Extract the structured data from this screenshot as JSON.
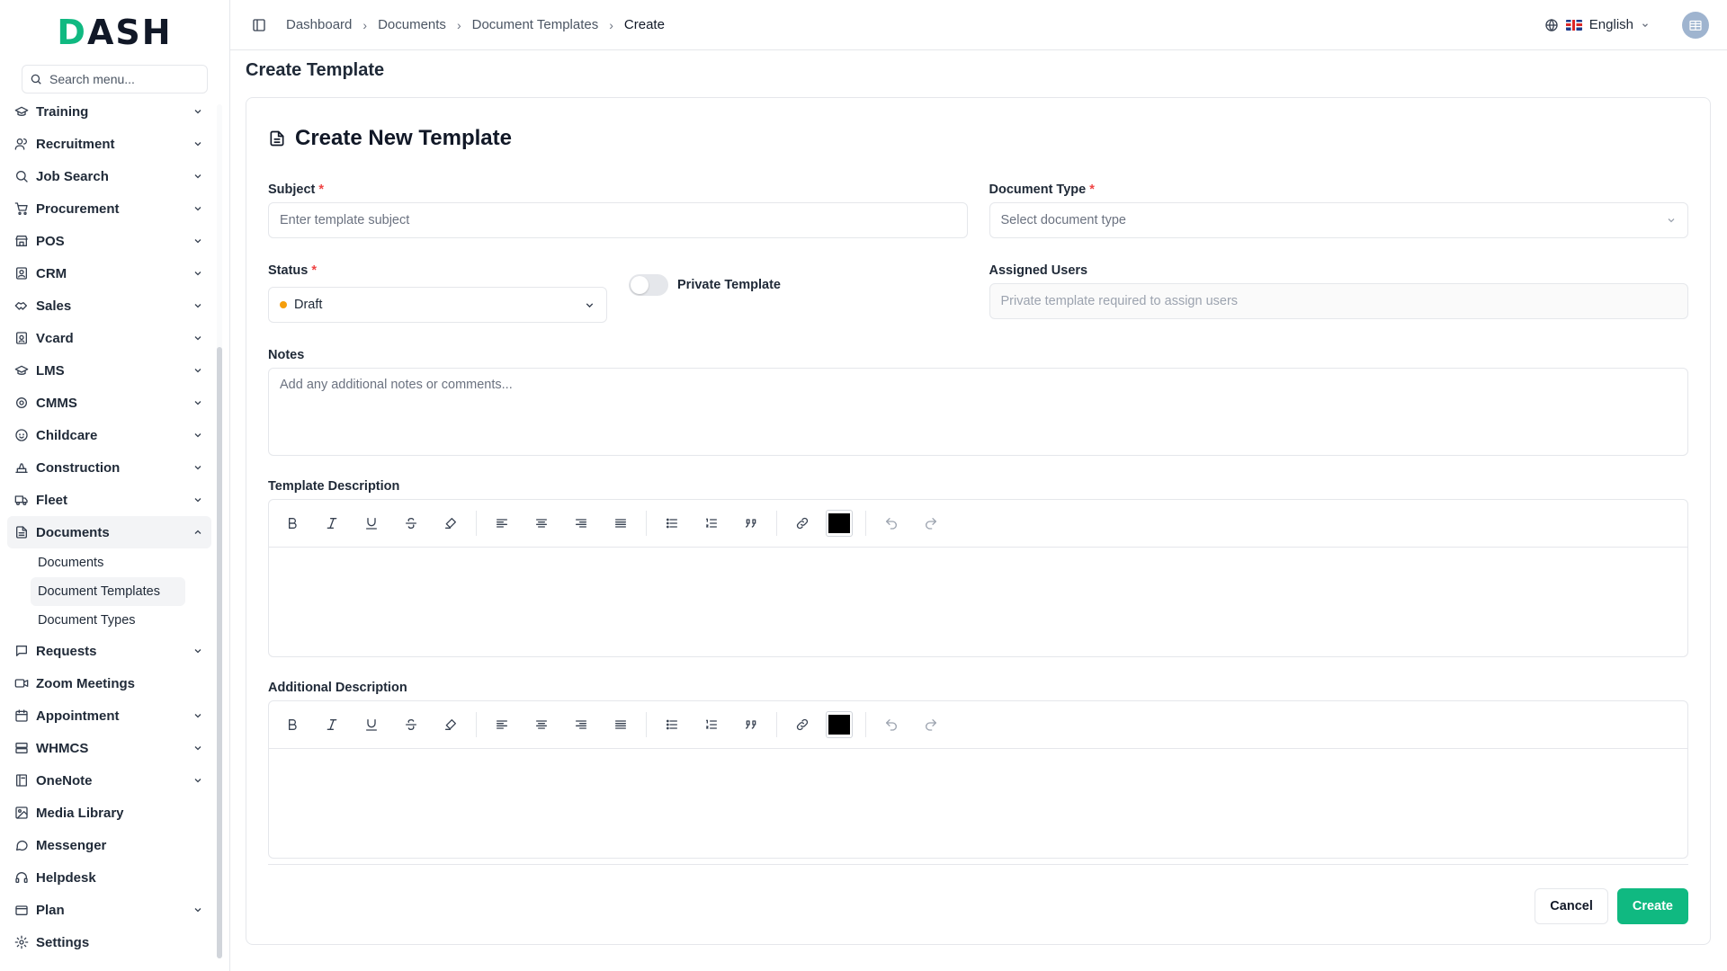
{
  "app": {
    "logo": "DASH"
  },
  "sidebar": {
    "search_placeholder": "Search menu...",
    "items": [
      {
        "label": "Training",
        "icon": "graduation-icon",
        "chevron": "down"
      },
      {
        "label": "Recruitment",
        "icon": "users-icon",
        "chevron": "down"
      },
      {
        "label": "Job Search",
        "icon": "search-icon",
        "chevron": "down"
      },
      {
        "label": "Procurement",
        "icon": "cart-icon",
        "chevron": "down"
      },
      {
        "label": "POS",
        "icon": "store-icon",
        "chevron": "down"
      },
      {
        "label": "CRM",
        "icon": "contact-icon",
        "chevron": "down"
      },
      {
        "label": "Sales",
        "icon": "handshake-icon",
        "chevron": "down"
      },
      {
        "label": "Vcard",
        "icon": "id-card-icon",
        "chevron": "down"
      },
      {
        "label": "LMS",
        "icon": "mortarboard-icon",
        "chevron": "down"
      },
      {
        "label": "CMMS",
        "icon": "cog-icon",
        "chevron": "down"
      },
      {
        "label": "Childcare",
        "icon": "baby-icon",
        "chevron": "down"
      },
      {
        "label": "Construction",
        "icon": "construction-icon",
        "chevron": "down"
      },
      {
        "label": "Fleet",
        "icon": "truck-icon",
        "chevron": "down"
      },
      {
        "label": "Documents",
        "icon": "file-icon",
        "chevron": "up",
        "active": true,
        "children": [
          "Documents",
          "Document Templates",
          "Document Types"
        ],
        "active_child": 1
      },
      {
        "label": "Requests",
        "icon": "message-icon",
        "chevron": "down"
      },
      {
        "label": "Zoom Meetings",
        "icon": "video-icon",
        "chevron": ""
      },
      {
        "label": "Appointment",
        "icon": "calendar-icon",
        "chevron": "down"
      },
      {
        "label": "WHMCS",
        "icon": "server-icon",
        "chevron": "down"
      },
      {
        "label": "OneNote",
        "icon": "notebook-icon",
        "chevron": "down"
      },
      {
        "label": "Media Library",
        "icon": "image-icon",
        "chevron": ""
      },
      {
        "label": "Messenger",
        "icon": "chat-icon",
        "chevron": ""
      },
      {
        "label": "Helpdesk",
        "icon": "headset-icon",
        "chevron": ""
      },
      {
        "label": "Plan",
        "icon": "wallet-icon",
        "chevron": "down"
      },
      {
        "label": "Settings",
        "icon": "settings-icon",
        "chevron": ""
      }
    ]
  },
  "topbar": {
    "breadcrumb": [
      "Dashboard",
      "Documents",
      "Document Templates",
      "Create"
    ],
    "language": "English"
  },
  "page": {
    "title": "Create Template",
    "card_title": "Create New Template",
    "subject": {
      "label": "Subject",
      "placeholder": "Enter template subject",
      "required": "*"
    },
    "document_type": {
      "label": "Document Type",
      "placeholder": "Select document type",
      "required": "*"
    },
    "status": {
      "label": "Status",
      "value": "Draft",
      "required": "*"
    },
    "private_template": {
      "label": "Private Template",
      "on": false
    },
    "assigned_users": {
      "label": "Assigned Users",
      "placeholder": "Private template required to assign users"
    },
    "notes": {
      "label": "Notes",
      "placeholder": "Add any additional notes or comments..."
    },
    "template_description": {
      "label": "Template Description"
    },
    "additional_description": {
      "label": "Additional Description"
    },
    "editor_color": "#000000",
    "cancel_label": "Cancel",
    "create_label": "Create"
  },
  "colors": {
    "accent": "#10b981",
    "status_draft": "#f59e0b",
    "required": "#ef4444"
  }
}
